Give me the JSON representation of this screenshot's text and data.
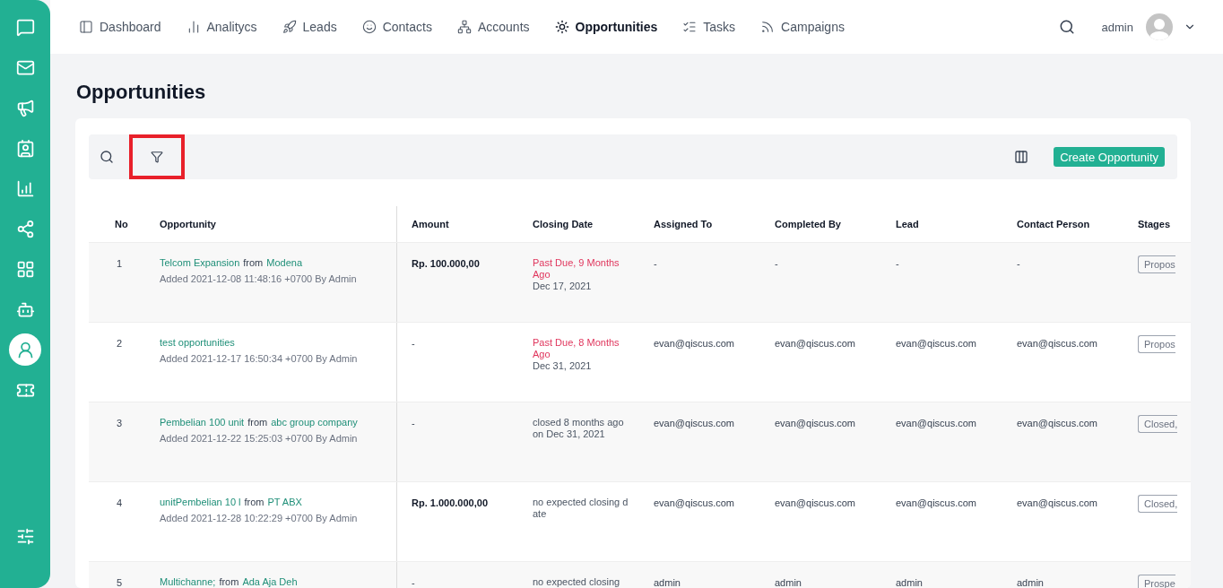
{
  "sidebar": {
    "items": [
      {
        "selected": false
      },
      {
        "selected": false
      },
      {
        "selected": false
      },
      {
        "selected": false
      },
      {
        "selected": false
      },
      {
        "selected": false
      },
      {
        "selected": false
      },
      {
        "selected": false
      },
      {
        "selected": true
      },
      {
        "selected": false
      }
    ]
  },
  "nav": {
    "items": [
      {
        "label": "Dashboard",
        "selected": false
      },
      {
        "label": "Analitycs",
        "selected": false
      },
      {
        "label": "Leads",
        "selected": false
      },
      {
        "label": "Contacts",
        "selected": false
      },
      {
        "label": "Accounts",
        "selected": false
      },
      {
        "label": "Opportunities",
        "selected": true
      },
      {
        "label": "Tasks",
        "selected": false
      },
      {
        "label": "Campaigns",
        "selected": false
      }
    ],
    "user": "admin"
  },
  "page_title": "Opportunities",
  "toolbar": {
    "filter_highlighted": true,
    "create_button": "Create Opportunity"
  },
  "table": {
    "columns": [
      "No",
      "Opportunity",
      "Amount",
      "Closing Date",
      "Assigned To",
      "Completed By",
      "Lead",
      "Contact Person",
      "Stages"
    ],
    "rows": [
      {
        "no": "1",
        "title": [
          {
            "text": "Telcom Expansion",
            "kind": "link"
          },
          {
            "text": "from",
            "kind": "plain"
          },
          {
            "text": "Modena",
            "kind": "link"
          }
        ],
        "added": "Added 2021-12-08 11:48:16 +0700 By Admin",
        "amount": "Rp. 100.000,00",
        "closing": [
          {
            "text": "Past Due, 9 Months Ago",
            "kind": "overdue"
          },
          {
            "text": "Dec 17, 2021",
            "kind": "plain"
          }
        ],
        "assigned": "-",
        "completed": "-",
        "lead": "-",
        "contact": "-",
        "stage": "Propos"
      },
      {
        "no": "2",
        "title": [
          {
            "text": "test opportunities",
            "kind": "link"
          }
        ],
        "added": "Added 2021-12-17 16:50:34 +0700 By Admin",
        "amount": "-",
        "closing": [
          {
            "text": "Past Due, 8 Months Ago",
            "kind": "overdue"
          },
          {
            "text": "Dec 31, 2021",
            "kind": "plain"
          }
        ],
        "assigned": "evan@qiscus.com",
        "completed": "evan@qiscus.com",
        "lead": "evan@qiscus.com",
        "contact": "evan@qiscus.com",
        "stage": "Propos"
      },
      {
        "no": "3",
        "title": [
          {
            "text": "Pembelian 100 unit",
            "kind": "link"
          },
          {
            "text": "from",
            "kind": "plain"
          },
          {
            "text": "abc group company",
            "kind": "link"
          }
        ],
        "added": "Added 2021-12-22 15:25:03 +0700 By Admin",
        "amount": "-",
        "closing": [
          {
            "text": "closed 8 months ago on Dec 31, 2021",
            "kind": "plain"
          }
        ],
        "assigned": "evan@qiscus.com",
        "completed": "evan@qiscus.com",
        "lead": "evan@qiscus.com",
        "contact": "evan@qiscus.com",
        "stage": "Closed,"
      },
      {
        "no": "4",
        "title": [
          {
            "text": "unitPembelian 10 l",
            "kind": "link"
          },
          {
            "text": "from",
            "kind": "plain"
          },
          {
            "text": "PT ABX",
            "kind": "link"
          }
        ],
        "added": "Added 2021-12-28 10:22:29 +0700 By Admin",
        "amount": "Rp. 1.000.000,00",
        "closing": [
          {
            "text": "no expected closing date",
            "kind": "plain"
          }
        ],
        "assigned": "evan@qiscus.com",
        "completed": "evan@qiscus.com",
        "lead": "evan@qiscus.com",
        "contact": "evan@qiscus.com",
        "stage": "Closed,"
      },
      {
        "no": "5",
        "title": [
          {
            "text": "Multichanne;",
            "kind": "link"
          },
          {
            "text": "from",
            "kind": "plain"
          },
          {
            "text": "Ada Aja Deh",
            "kind": "link"
          }
        ],
        "amount": "-",
        "closing": [
          {
            "text": "no expected closing",
            "kind": "plain"
          }
        ],
        "assigned": "admin",
        "completed": "admin",
        "lead": "admin",
        "contact": "admin",
        "stage": "Prospe"
      }
    ]
  }
}
